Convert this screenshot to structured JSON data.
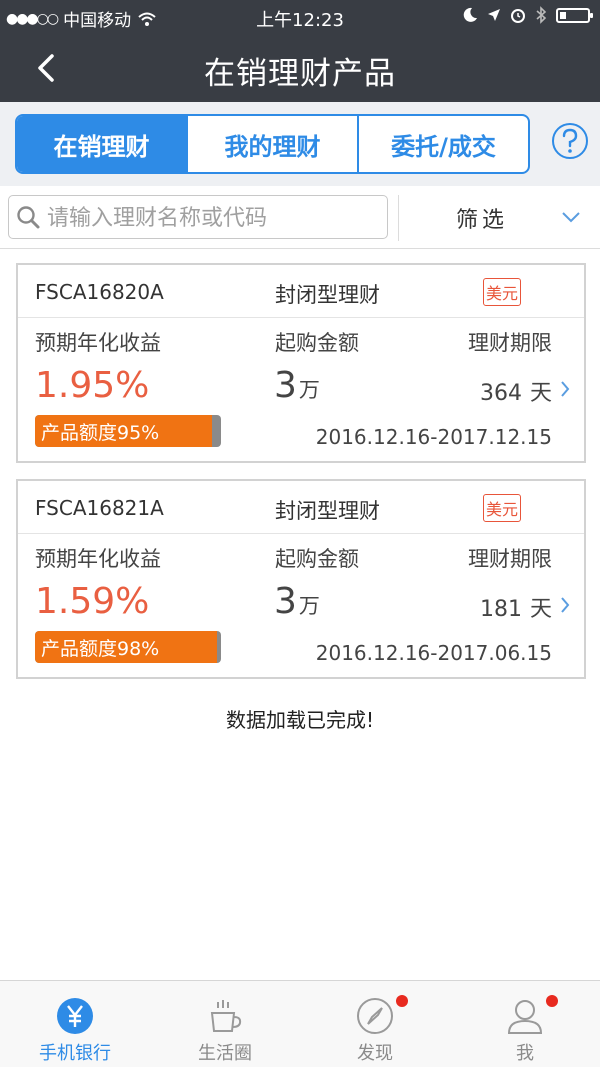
{
  "status_bar": {
    "carrier": "中国移动",
    "time": "上午12:23"
  },
  "nav": {
    "title": "在销理财产品"
  },
  "tabs": [
    {
      "label": "在销理财",
      "active": true
    },
    {
      "label": "我的理财",
      "active": false
    },
    {
      "label": "委托/成交",
      "active": false
    }
  ],
  "search": {
    "placeholder": "请输入理财名称或代码",
    "value": ""
  },
  "filter": {
    "label": "筛选"
  },
  "products": [
    {
      "code": "FSCA16820A",
      "type": "封闭型理财",
      "currency": "美元",
      "rate_label": "预期年化收益",
      "amount_label": "起购金额",
      "term_label": "理财期限",
      "rate": "1.95%",
      "amount": "3",
      "amount_unit": "万",
      "term": "364",
      "term_unit": "天",
      "quota_text": "产品额度95%",
      "quota_fraction": 0.95,
      "dates": "2016.12.16-2017.12.15"
    },
    {
      "code": "FSCA16821A",
      "type": "封闭型理财",
      "currency": "美元",
      "rate_label": "预期年化收益",
      "amount_label": "起购金额",
      "term_label": "理财期限",
      "rate": "1.59%",
      "amount": "3",
      "amount_unit": "万",
      "term": "181",
      "term_unit": "天",
      "quota_text": "产品额度98%",
      "quota_fraction": 0.98,
      "dates": "2016.12.16-2017.06.15"
    }
  ],
  "load_status": "数据加载已完成!",
  "tab_bar": [
    {
      "label": "手机银行",
      "icon": "yuan-icon",
      "active": true,
      "badge": false
    },
    {
      "label": "生活圈",
      "icon": "coffee-cup-icon",
      "active": false,
      "badge": false
    },
    {
      "label": "发现",
      "icon": "compass-icon",
      "active": false,
      "badge": true
    },
    {
      "label": "我",
      "icon": "user-icon",
      "active": false,
      "badge": true
    }
  ],
  "colors": {
    "header_bg": "#393d44",
    "accent_blue": "#2e8be6",
    "rate_red": "#e95f41",
    "quota_orange": "#f07313",
    "badge_red": "#e82a1f"
  }
}
